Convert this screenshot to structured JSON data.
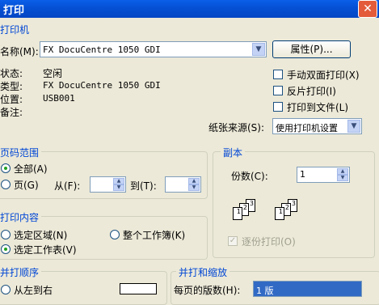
{
  "window": {
    "title": "打印",
    "close_glyph": "✕"
  },
  "printer": {
    "section_title": "打印机",
    "name_label": "名称(M):",
    "name_value": "FX DocuCentre 1050 GDI",
    "properties_button": "属性(P)...",
    "status_label": "状态:",
    "status_value": "空闲",
    "type_label": "类型:",
    "type_value": "FX DocuCentre 1050 GDI",
    "location_label": "位置:",
    "location_value": "USB001",
    "comment_label": "备注:",
    "manual_duplex": "手动双面打印(X)",
    "reverse_print": "反片打印(I)",
    "print_to_file": "打印到文件(L)",
    "paper_source_label": "纸张来源(S):",
    "paper_source_value": "使用打印机设置"
  },
  "page_range": {
    "section_title": "页码范围",
    "all_label": "全部(A)",
    "pages_label": "页(G)",
    "from_label": "从(F):",
    "to_label": "到(T):",
    "from_value": "",
    "to_value": ""
  },
  "copies": {
    "section_title": "副本",
    "count_label": "份数(C):",
    "count_value": "1",
    "collate_label": "逐份打印(O)",
    "collate_checked": true
  },
  "print_what": {
    "section_title": "打印内容",
    "selection_label": "选定区域(N)",
    "entire_workbook_label": "整个工作簿(K)",
    "active_sheets_label": "选定工作表(V)"
  },
  "print_order": {
    "section_title": "并打顺序",
    "first_option": "从左到右"
  },
  "zoom": {
    "section_title": "并打和缩放",
    "pages_per_sheet_label": "每页的版数(H):",
    "pages_per_sheet_value": "1 版"
  }
}
